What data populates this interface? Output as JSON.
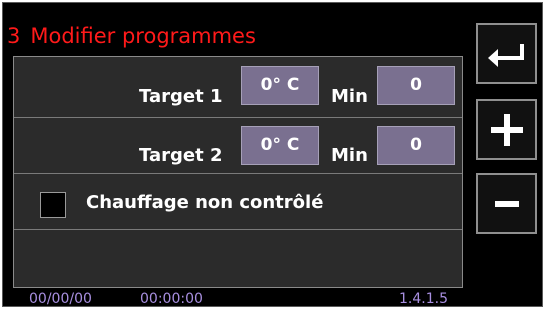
{
  "header": {
    "program_number": "3",
    "title": "Modifier programmes"
  },
  "targets": [
    {
      "label": "Target 1",
      "temperature": "0° C",
      "min_label": "Min",
      "minutes": "0"
    },
    {
      "label": "Target 2",
      "temperature": "0° C",
      "min_label": "Min",
      "minutes": "0"
    }
  ],
  "heating": {
    "label": "Chauffage non contrôlé",
    "checked": false
  },
  "footer": {
    "date": "00/00/00",
    "time": "00:00:00",
    "version": "1.4.1.5"
  },
  "side_buttons": {
    "back_icon": "return-arrow-icon",
    "plus_icon": "plus-icon",
    "minus_icon": "minus-icon"
  },
  "colors": {
    "title": "#ff1a1a",
    "field_bg": "#7a7090",
    "footer_text": "#a88fe0",
    "panel_bg": "#2b2b2b"
  }
}
